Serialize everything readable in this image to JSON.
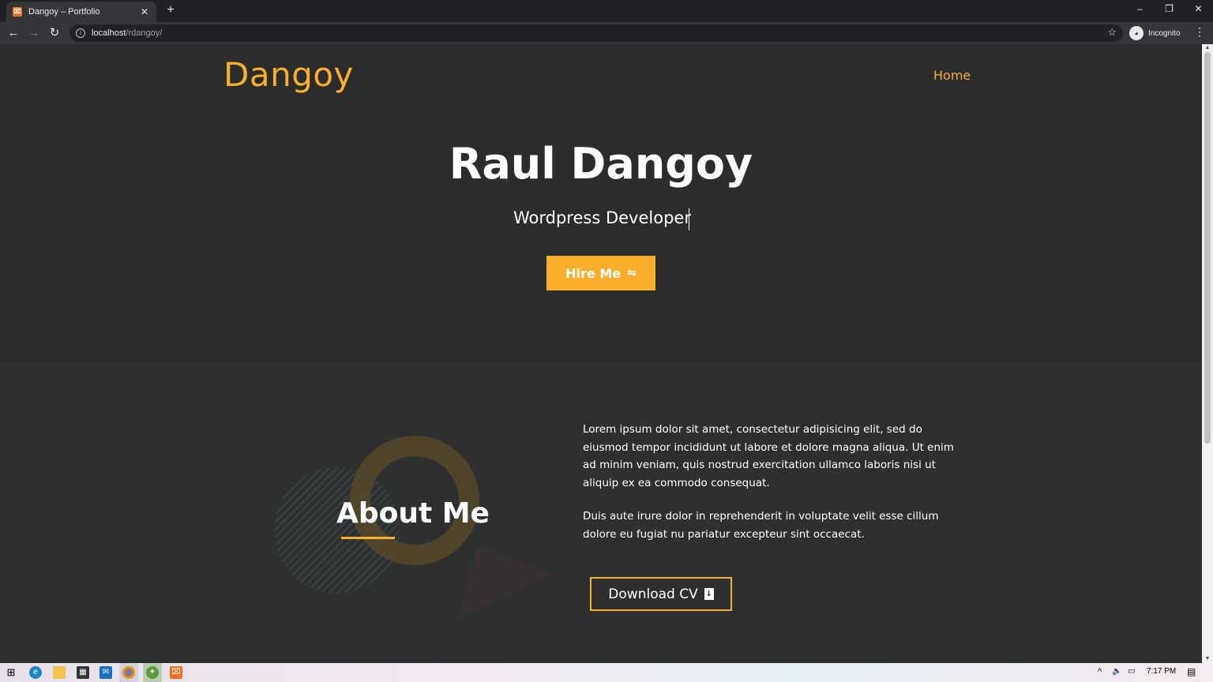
{
  "browser": {
    "tab_title": "Dangoy – Portfolio",
    "tab_favicon": "xampp-favicon",
    "new_tab_glyph": "+",
    "close_glyph": "✕",
    "url_host": "localhost",
    "url_path": "/rdangoy/",
    "incognito_label": "Incognito",
    "window_controls": [
      "–",
      "❐",
      "✕"
    ],
    "nav": {
      "back": "←",
      "forward": "→",
      "reload": "↻",
      "star": "☆",
      "menu": "⋮",
      "info": "i"
    }
  },
  "site": {
    "logo": "Dangoy",
    "nav_home": "Home",
    "accent_color": "#fbae2b"
  },
  "hero": {
    "name": "Raul Dangoy",
    "role": "Wordpress Developer",
    "hire_label": "Hire Me",
    "hire_icon": "handshake-icon"
  },
  "about": {
    "title": "About Me",
    "paragraph_1": "Lorem ipsum dolor sit amet, consectetur adipisicing elit, sed do eiusmod tempor incididunt ut labore et dolore magna aliqua. Ut enim ad minim veniam, quis nostrud exercitation ullamco laboris nisi ut aliquip ex ea commodo consequat.",
    "paragraph_2": "Duis aute irure dolor in reprehenderit in voluptate velit esse cillum dolore eu fugiat nu pariatur excepteur sint occaecat.",
    "cv_label": "Download CV",
    "cv_icon": "file-download-icon"
  },
  "taskbar": {
    "time": "7:17 PM",
    "icons": [
      "windows-start-icon",
      "edge-icon",
      "file-explorer-icon",
      "store-icon",
      "mail-icon",
      "chrome-icon",
      "app-icon",
      "xampp-icon"
    ]
  }
}
